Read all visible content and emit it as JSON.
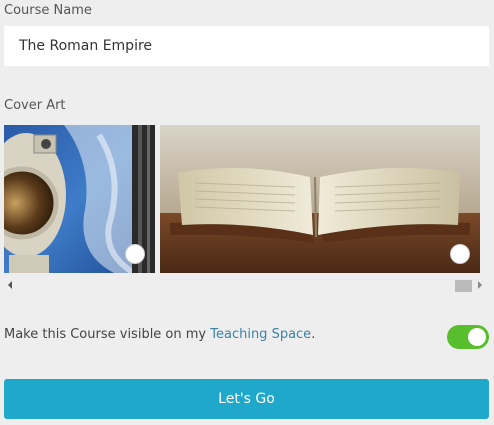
{
  "course_name": {
    "label": "Course Name",
    "value": "The Roman Empire"
  },
  "cover_art": {
    "label": "Cover Art",
    "images": [
      {
        "icon": "astronaut-space-image",
        "selected": false
      },
      {
        "icon": "open-book-image",
        "selected": false
      }
    ]
  },
  "visibility": {
    "text_before": "Make this Course visible on my ",
    "link": "Teaching Space",
    "text_after": ".",
    "enabled": true,
    "toggle_color": "#58be2b"
  },
  "submit": {
    "label": "Let's Go",
    "color": "#1fa8c9"
  }
}
